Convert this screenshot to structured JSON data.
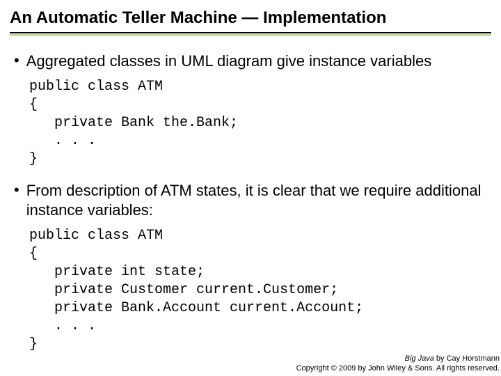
{
  "title": "An Automatic Teller Machine — Implementation",
  "bullets": {
    "b1": "Aggregated classes in UML diagram give instance variables",
    "b2": "From description of ATM states, it is clear that we require additional instance variables:"
  },
  "code": {
    "block1": "public class ATM\n{\n   private Bank the.Bank;\n   . . .\n}",
    "block2": "public class ATM\n{\n   private int state;\n   private Customer current.Customer;\n   private Bank.Account current.Account;\n   . . .\n}"
  },
  "footer": {
    "book": "Big Java",
    "author": " by Cay Horstmann",
    "copyright": "Copyright © 2009 by John Wiley & Sons. All rights reserved."
  }
}
